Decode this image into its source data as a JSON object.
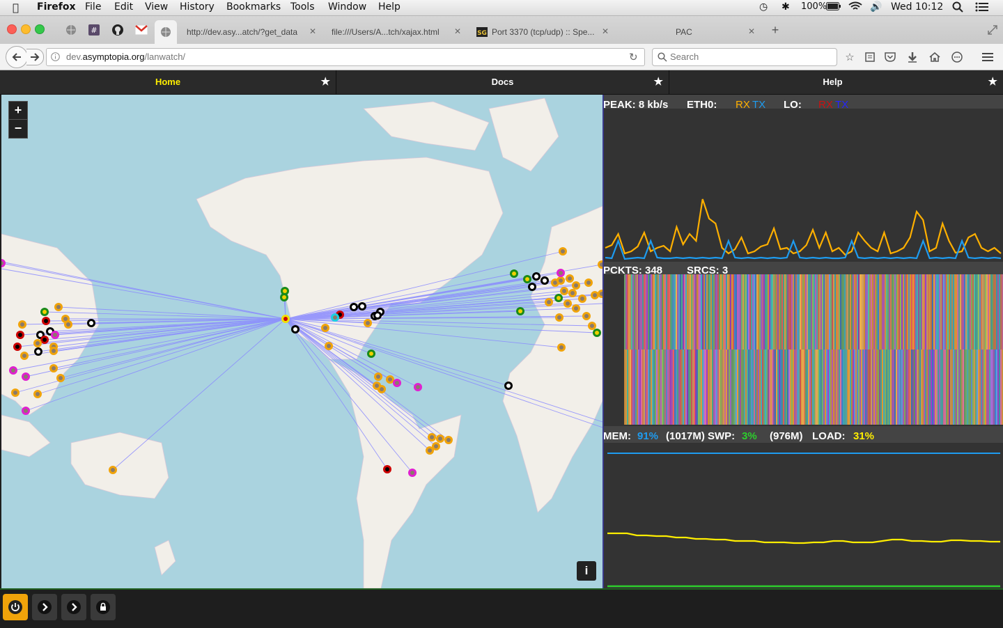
{
  "menubar": {
    "app": "Firefox",
    "items": [
      "File",
      "Edit",
      "View",
      "History",
      "Bookmarks",
      "Tools",
      "Window",
      "Help"
    ],
    "battery": "100%",
    "clock": "Wed 10:12"
  },
  "tabs": [
    {
      "label": "http://dev.asy...atch/?get_data",
      "active": false
    },
    {
      "label": "file:///Users/A...tch/xajax.html",
      "active": false
    },
    {
      "label": "Port 3370 (tcp/udp) :: Spe...",
      "active": false
    },
    {
      "label": "PAC",
      "active": false
    }
  ],
  "navbar": {
    "url_prefix": "dev.",
    "url_domain": "asymptopia.org",
    "url_path": "/lanwatch/",
    "search_placeholder": "Search"
  },
  "site_nav": {
    "items": [
      {
        "label": "Home",
        "active": true
      },
      {
        "label": "Docs",
        "active": false
      },
      {
        "label": "Help",
        "active": false
      }
    ]
  },
  "map": {
    "zoom_in": "+",
    "zoom_out": "−",
    "info": "i"
  },
  "net": {
    "peak_label": "PEAK: 8 kb/s",
    "eth0_label": "ETH0:",
    "rx": "RX",
    "tx": "TX",
    "lo_label": "LO:",
    "rx_color": "#ffb000",
    "tx_color": "#1e9cf0",
    "lo_rx_color": "#cc1010",
    "lo_tx_color": "#2424ff"
  },
  "packets": {
    "pckts_label": "PCKTS: 348",
    "srcs_label": "SRCS: 3"
  },
  "system": {
    "mem_label": "MEM:",
    "mem_pct": "91%",
    "mem_total": "(1017M)",
    "swp_label": "SWP:",
    "swp_pct": "3%",
    "swp_total": "(976M)",
    "load_label": "LOAD:",
    "load_pct": "31%",
    "mem_color": "#1e9cf0",
    "swp_color": "#2ccf2c",
    "load_color": "#ffee00"
  },
  "colors": {
    "map_water": "#aad3df",
    "map_land": "#f2efe9",
    "route_line": "#8a8aff",
    "panel_bg": "#333333",
    "accent_orange": "#f0a30a"
  },
  "icons": {
    "power": "power-icon",
    "step1": "chevron-right-icon",
    "step2": "chevron-right-icon",
    "lock": "lock-icon"
  }
}
